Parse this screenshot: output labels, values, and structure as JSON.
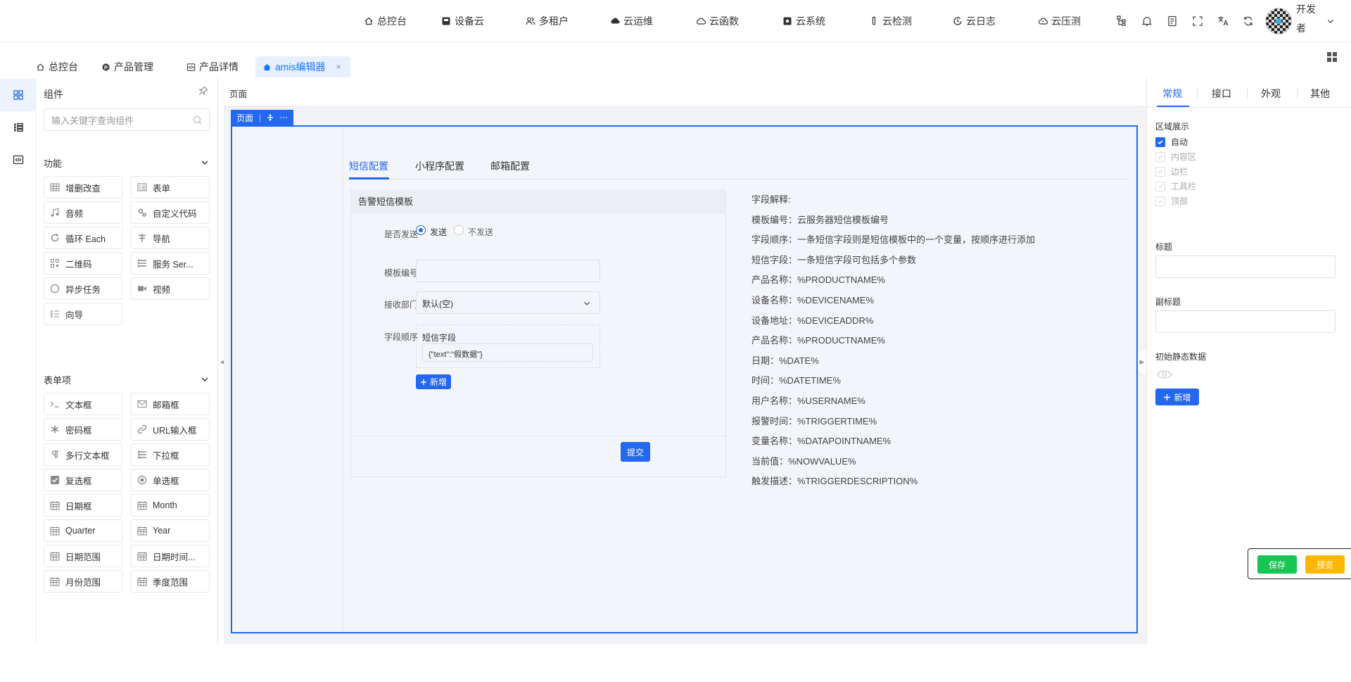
{
  "topnav": {
    "items": [
      {
        "label": "总控台",
        "icon": "home-icon"
      },
      {
        "label": "设备云",
        "icon": "device-icon"
      },
      {
        "label": "多租户",
        "icon": "users-icon"
      },
      {
        "label": "云运维",
        "icon": "cloud-ops-icon"
      },
      {
        "label": "云函数",
        "icon": "cloud-icon"
      },
      {
        "label": "云系统",
        "icon": "system-icon"
      },
      {
        "label": "云检测",
        "icon": "test-tube-icon"
      },
      {
        "label": "云日志",
        "icon": "log-icon"
      },
      {
        "label": "云压测",
        "icon": "cloud-stress-icon"
      }
    ],
    "user_name": "开发者"
  },
  "page_tabs": [
    {
      "label": "总控台"
    },
    {
      "label": "产品管理"
    },
    {
      "label": "产品详情"
    },
    {
      "label": "amis编辑器",
      "close": "×"
    }
  ],
  "left_panel": {
    "title": "组件",
    "search_placeholder": "输入关键字查询组件",
    "groups": [
      {
        "title": "功能",
        "items": [
          "增删改查",
          "表单",
          "音频",
          "自定义代码",
          "循环 Each",
          "导航",
          "二维码",
          "服务 Ser...",
          "异步任务",
          "视频",
          "向导"
        ]
      },
      {
        "title": "表单项",
        "items": [
          "文本框",
          "邮箱框",
          "密码框",
          "URL输入框",
          "多行文本框",
          "下拉框",
          "复选框",
          "单选框",
          "日期框",
          "Month",
          "Quarter",
          "Year",
          "日期范围",
          "日期时间...",
          "月份范围",
          "季度范围"
        ]
      }
    ]
  },
  "canvas": {
    "breadcrumb": "页面",
    "frame_label": "页面",
    "frame_more": "⋯",
    "tabs": [
      "短信配置",
      "小程序配置",
      "邮箱配置"
    ],
    "form": {
      "header": "告警短信模板",
      "send_label": "是否发送",
      "send_options": [
        "发送",
        "不发送"
      ],
      "template_label": "模板编号",
      "template_value": "",
      "dept_label": "接收部门",
      "dept_value": "默认(空)",
      "field_order_label": "字段顺序",
      "sms_field_label": "短信字段",
      "sms_field_value": "{\"text\":\"假数据\"}",
      "add_label": "新增",
      "submit_label": "提交"
    },
    "explanations": [
      "字段解释:",
      "模板编号：云服务器短信模板编号",
      "字段顺序：一条短信字段则是短信模板中的一个变量，按顺序进行添加",
      "短信字段：一条短信字段可包括多个参数",
      "产品名称：%PRODUCTNAME%",
      "设备名称：%DEVICENAME%",
      "设备地址：%DEVICEADDR%",
      "产品名称：%PRODUCTNAME%",
      "日期：%DATE%",
      "时间：%DATETIME%",
      "用户名称：%USERNAME%",
      "报警时间：%TRIGGERTIME%",
      "变量名称：%DATAPOINTNAME%",
      "当前值：%NOWVALUE%",
      "触发描述：%TRIGGERDESCRIPTION%"
    ]
  },
  "right_panel": {
    "tabs": [
      "常规",
      "接口",
      "外观",
      "其他"
    ],
    "region_label": "区域展示",
    "regions": [
      {
        "label": "自动",
        "checked": true
      },
      {
        "label": "内容区",
        "checked": false
      },
      {
        "label": "边栏",
        "checked": false
      },
      {
        "label": "工具栏",
        "checked": false
      },
      {
        "label": "顶部",
        "checked": false
      }
    ],
    "title_label": "标题",
    "subtitle_label": "副标题",
    "init_data_label": "初始静态数据",
    "add_label": "新增"
  },
  "actions": {
    "save": "保存",
    "preview": "预览"
  },
  "colors": {
    "primary": "#2468f2",
    "save": "#17c653",
    "preview": "#ffb800"
  }
}
